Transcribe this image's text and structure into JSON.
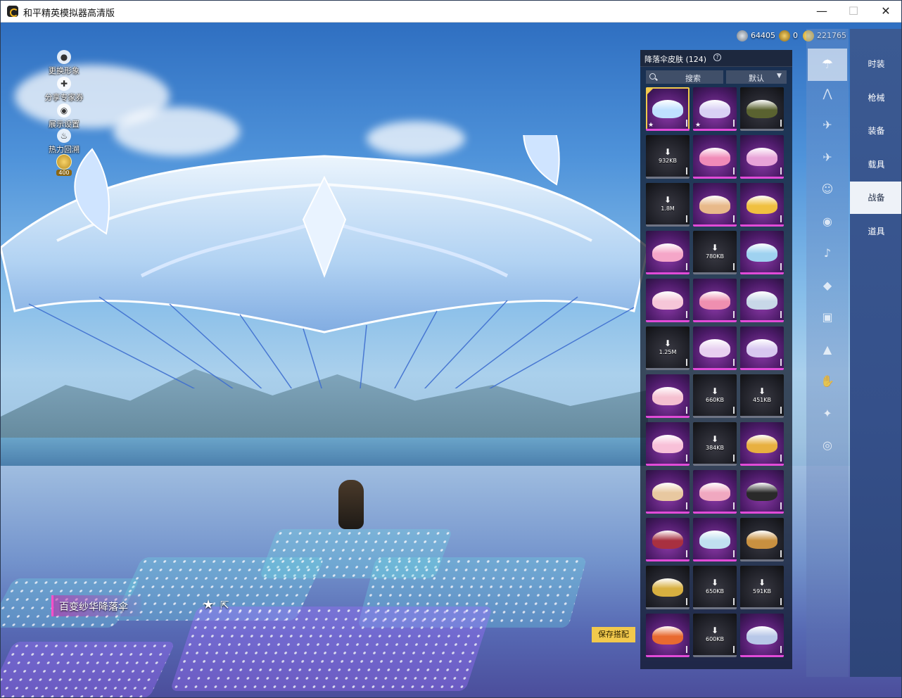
{
  "window": {
    "title": "和平精英模拟器高清版",
    "min": "—",
    "max": "☐",
    "close": "✕"
  },
  "left_menu": [
    {
      "label": "更换形象",
      "icon": "person-icon"
    },
    {
      "label": "分享专家券",
      "icon": "share-coupon-icon"
    },
    {
      "label": "展示设置",
      "icon": "eye-icon"
    },
    {
      "label": "热力回溯",
      "icon": "flame-icon"
    }
  ],
  "badge": {
    "label": "400",
    "icon": "level-badge-icon"
  },
  "currency": [
    {
      "value": "64405",
      "color": "#9aa4b4",
      "icon": "silver-coin-icon"
    },
    {
      "value": "0",
      "color": "#d7a928",
      "icon": "gold-medal-icon"
    },
    {
      "value": "221765",
      "color": "#f2c94c",
      "icon": "coupon-coin-icon"
    }
  ],
  "inventory": {
    "title": "降落伞皮肤 (124)",
    "help": "?",
    "search_label": "搜索",
    "sort_label": "默认",
    "items": [
      {
        "rarity": "purple",
        "color": "#bfe0ff",
        "star": "★",
        "selected": true
      },
      {
        "rarity": "purple",
        "color": "#d9d0f4",
        "star": "★"
      },
      {
        "rarity": "dark",
        "color": "#5a6230"
      },
      {
        "rarity": "dark",
        "download": "932KB"
      },
      {
        "rarity": "purple",
        "color": "#f08bb8"
      },
      {
        "rarity": "purple",
        "color": "#e8a4d8"
      },
      {
        "rarity": "dark",
        "download": "1.8M"
      },
      {
        "rarity": "purple",
        "color": "#e8b98a"
      },
      {
        "rarity": "purple",
        "color": "#f0c040"
      },
      {
        "rarity": "purple",
        "color": "#f5a6c8"
      },
      {
        "rarity": "dark",
        "download": "780KB"
      },
      {
        "rarity": "purple",
        "color": "#9fd2f0"
      },
      {
        "rarity": "purple",
        "color": "#f6c6d8"
      },
      {
        "rarity": "purple",
        "color": "#ef8fb0"
      },
      {
        "rarity": "purple",
        "color": "#c8d8e8"
      },
      {
        "rarity": "dark",
        "download": "1.25M"
      },
      {
        "rarity": "purple",
        "color": "#e8d0f0"
      },
      {
        "rarity": "purple",
        "color": "#d8c8f0"
      },
      {
        "rarity": "purple",
        "color": "#f5c0d0"
      },
      {
        "rarity": "dark",
        "download": "660KB"
      },
      {
        "rarity": "dark",
        "download": "451KB"
      },
      {
        "rarity": "purple",
        "color": "#f8c0d8"
      },
      {
        "rarity": "dark",
        "download": "384KB"
      },
      {
        "rarity": "purple",
        "color": "#e8b040"
      },
      {
        "rarity": "purple",
        "color": "#e8c8a0"
      },
      {
        "rarity": "purple",
        "color": "#f0a8c0"
      },
      {
        "rarity": "purple",
        "color": "#2a2a2a"
      },
      {
        "rarity": "purple",
        "color": "#a83040"
      },
      {
        "rarity": "purple",
        "color": "#c0e0f0"
      },
      {
        "rarity": "dark",
        "color": "#c89040"
      },
      {
        "rarity": "dark",
        "color": "#d8b040"
      },
      {
        "rarity": "dark",
        "download": "650KB"
      },
      {
        "rarity": "dark",
        "download": "591KB"
      },
      {
        "rarity": "purple",
        "color": "#e86a30"
      },
      {
        "rarity": "dark",
        "download": "600KB"
      },
      {
        "rarity": "purple",
        "color": "#b8c8e8"
      }
    ]
  },
  "side_icons": [
    {
      "icon": "parachute-icon",
      "glyph": "☂",
      "active": true
    },
    {
      "icon": "wings-icon",
      "glyph": "⋀"
    },
    {
      "icon": "plane-icon",
      "glyph": "✈"
    },
    {
      "icon": "jet-icon",
      "glyph": "✈"
    },
    {
      "icon": "emote-icon",
      "glyph": "☺"
    },
    {
      "icon": "robot-icon",
      "glyph": "◉"
    },
    {
      "icon": "sound-icon",
      "glyph": "♪"
    },
    {
      "icon": "pet-icon",
      "glyph": "◆"
    },
    {
      "icon": "picture-icon",
      "glyph": "▣"
    },
    {
      "icon": "spray-icon",
      "glyph": "▲"
    },
    {
      "icon": "hand-icon",
      "glyph": "✋"
    },
    {
      "icon": "wand-icon",
      "glyph": "✦"
    },
    {
      "icon": "planet-icon",
      "glyph": "◎"
    }
  ],
  "categories": [
    {
      "label": "时装"
    },
    {
      "label": "枪械"
    },
    {
      "label": "装备"
    },
    {
      "label": "载具"
    },
    {
      "label": "战备",
      "active": true
    },
    {
      "label": "道具"
    }
  ],
  "panel_close": "✕",
  "item_name": "百变纱华降落伞",
  "fav_glyph": "★",
  "share_glyph": "⇱",
  "save_label": "保存搭配"
}
